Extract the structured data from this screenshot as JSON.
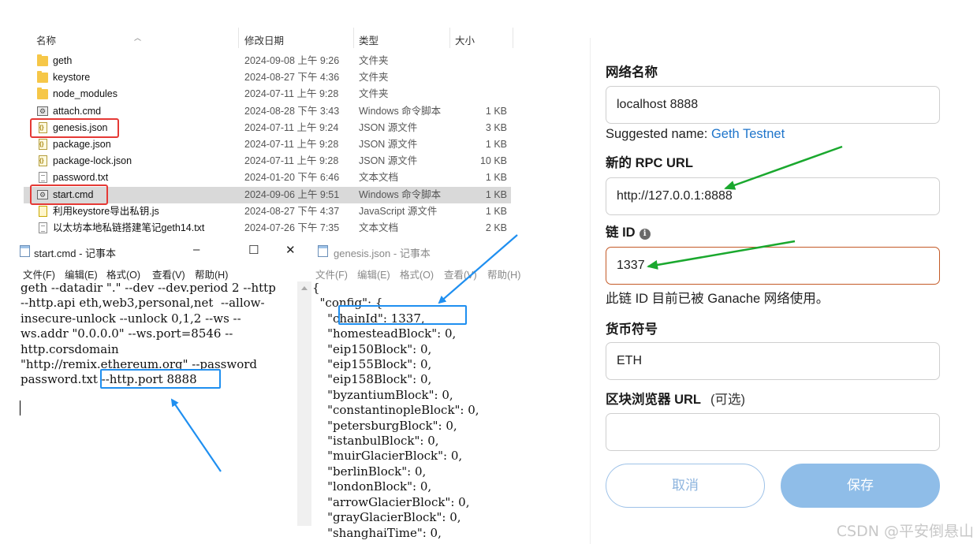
{
  "explorer": {
    "columns": [
      "名称",
      "修改日期",
      "类型",
      "大小"
    ],
    "files": [
      {
        "name": "geth",
        "date": "2024-09-08 上午 9:26",
        "type": "文件夹",
        "size": "",
        "icon": "folder-icon"
      },
      {
        "name": "keystore",
        "date": "2024-08-27 下午 4:36",
        "type": "文件夹",
        "size": "",
        "icon": "folder-icon"
      },
      {
        "name": "node_modules",
        "date": "2024-07-11 上午 9:28",
        "type": "文件夹",
        "size": "",
        "icon": "folder-icon"
      },
      {
        "name": "attach.cmd",
        "date": "2024-08-28 下午 3:43",
        "type": "Windows 命令脚本",
        "size": "1 KB",
        "icon": "cmd-file-icon"
      },
      {
        "name": "genesis.json",
        "date": "2024-07-11 上午 9:24",
        "type": "JSON 源文件",
        "size": "3 KB",
        "icon": "json-file-icon"
      },
      {
        "name": "package.json",
        "date": "2024-07-11 上午 9:28",
        "type": "JSON 源文件",
        "size": "1 KB",
        "icon": "json-file-icon"
      },
      {
        "name": "package-lock.json",
        "date": "2024-07-11 上午 9:28",
        "type": "JSON 源文件",
        "size": "10 KB",
        "icon": "json-file-icon"
      },
      {
        "name": "password.txt",
        "date": "2024-01-20 下午 6:46",
        "type": "文本文档",
        "size": "1 KB",
        "icon": "text-file-icon"
      },
      {
        "name": "start.cmd",
        "date": "2024-09-06 上午 9:51",
        "type": "Windows 命令脚本",
        "size": "1 KB",
        "icon": "cmd-file-icon"
      },
      {
        "name": "利用keystore导出私钥.js",
        "date": "2024-08-27 下午 4:37",
        "type": "JavaScript 源文件",
        "size": "1 KB",
        "icon": "js-file-icon"
      },
      {
        "name": "以太坊本地私链搭建笔记geth14.txt",
        "date": "2024-07-26 下午 7:35",
        "type": "文本文档",
        "size": "2 KB",
        "icon": "text-file-icon"
      }
    ]
  },
  "notepad_start": {
    "title": "start.cmd - 记事本",
    "menu": [
      "文件(F)",
      "编辑(E)",
      "格式(O)",
      "查看(V)",
      "帮助(H)"
    ],
    "controls": {
      "minimize": "–",
      "maximize": "☐",
      "close": "✕"
    },
    "lines": [
      "geth --datadir \".\" --dev --dev.period 2 --http",
      "--http.api eth,web3,personal,net  --allow-",
      "insecure-unlock --unlock 0,1,2 --ws --",
      "ws.addr \"0.0.0.0\" --ws.port=8546 --",
      "http.corsdomain",
      "\"http://remix.ethereum.org\" --password",
      "password.txt --http.port 8888"
    ]
  },
  "notepad_genesis": {
    "title": "genesis.json - 记事本",
    "menu": [
      "文件(F)",
      "编辑(E)",
      "格式(O)",
      "查看(V)",
      "帮助(H)"
    ],
    "lines": [
      "{",
      "  \"config\": {",
      "    \"chainId\": 1337,",
      "    \"homesteadBlock\": 0,",
      "    \"eip150Block\": 0,",
      "    \"eip155Block\": 0,",
      "    \"eip158Block\": 0,",
      "    \"byzantiumBlock\": 0,",
      "    \"constantinopleBlock\": 0,",
      "    \"petersburgBlock\": 0,",
      "    \"istanbulBlock\": 0,",
      "    \"muirGlacierBlock\": 0,",
      "    \"berlinBlock\": 0,",
      "    \"londonBlock\": 0,",
      "    \"arrowGlacierBlock\": 0,",
      "    \"grayGlacierBlock\": 0,",
      "    \"shanghaiTime\": 0,"
    ]
  },
  "network_form": {
    "network_name_label": "网络名称",
    "network_name_value": "localhost 8888",
    "suggested_prefix": "Suggested name:",
    "suggested_name": "Geth Testnet",
    "rpc_label": "新的 RPC URL",
    "rpc_value": "http://127.0.0.1:8888",
    "chain_id_label": "链 ID",
    "chain_id_value": "1337",
    "chain_id_warning": "此链 ID 目前已被 Ganache 网络使用。",
    "currency_label": "货币符号",
    "currency_value": "ETH",
    "explorer_label": "区块浏览器 URL",
    "explorer_optional": "(可选)",
    "explorer_value": "",
    "cancel_label": "取消",
    "save_label": "保存"
  },
  "watermark": "CSDN @平安倒悬山",
  "colors": {
    "highlight_red": "#e53935",
    "highlight_blue": "#1f8ff0",
    "arrow_green": "#1aa82e",
    "link_blue": "#1f75cb",
    "save_button": "#8fbde8",
    "error_border": "#c45a27"
  }
}
